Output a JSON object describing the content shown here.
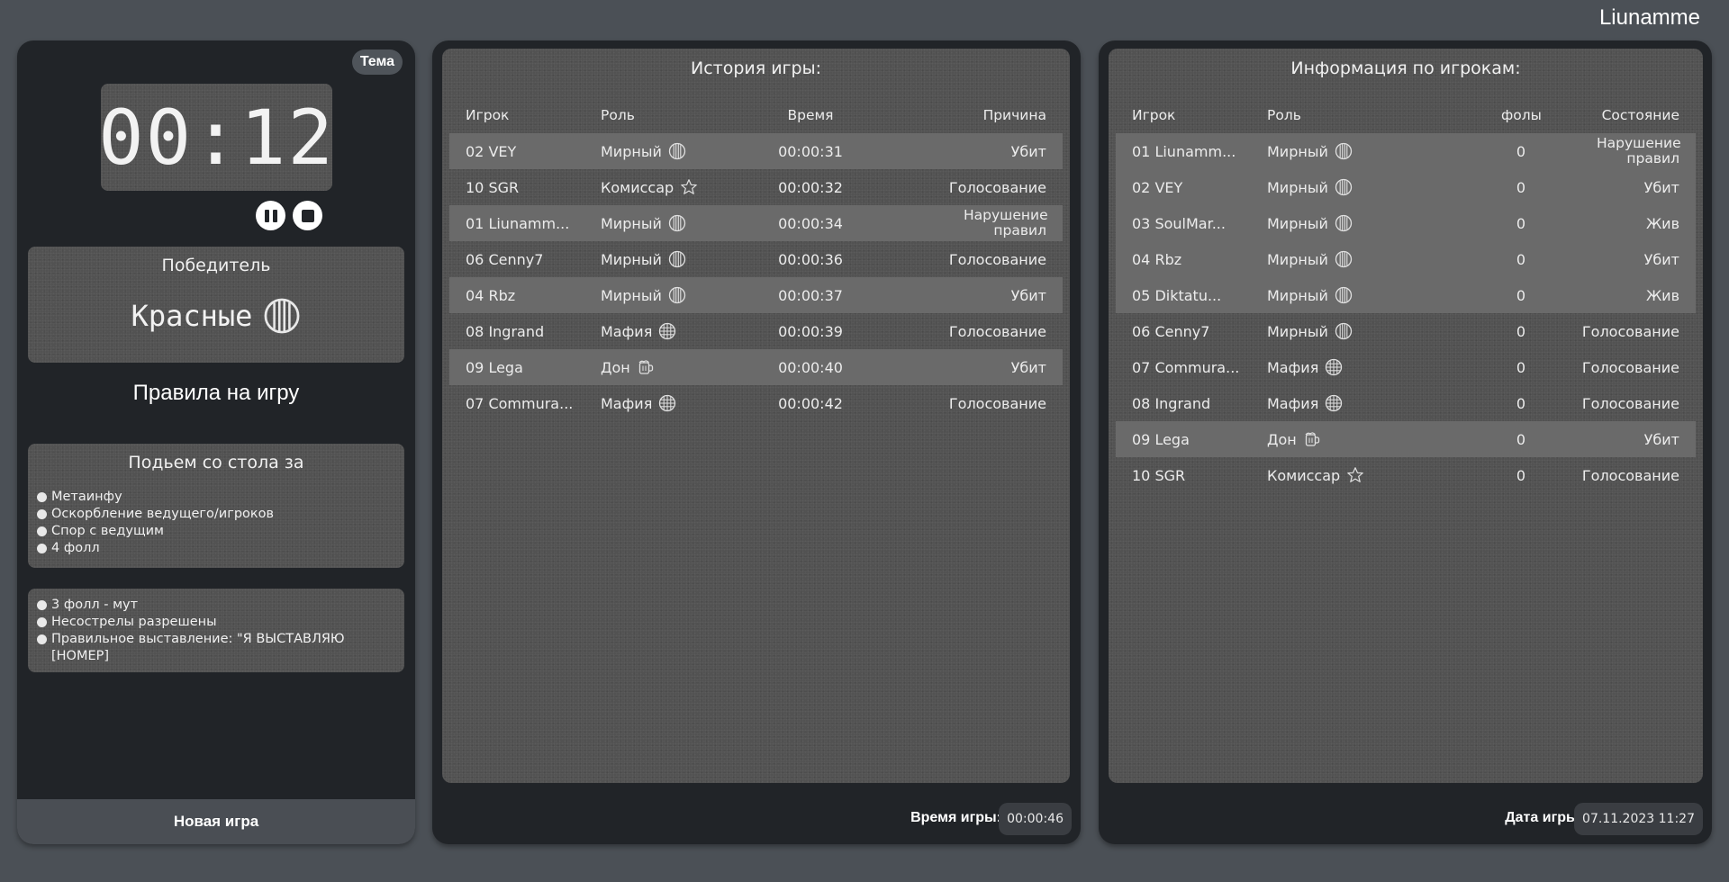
{
  "header": {
    "username": "Liunamme"
  },
  "left": {
    "theme_label": "Тема",
    "timer": "00:12",
    "winner": {
      "title": "Победитель",
      "team": "Красные",
      "team_icon": "striped-circle-icon"
    },
    "rules_title": "Правила на игру",
    "lift": {
      "title": "Подьем со стола за",
      "items": [
        "Метаинфу",
        "Оскорбление ведущего/игроков",
        "Спор с ведущим",
        "4 фолл"
      ]
    },
    "extra": {
      "items": [
        "3 фолл - мут",
        "Несострелы разрешены",
        "Правильное выставление: \"Я ВЫСТАВЛЯЮ [НОМЕР]"
      ]
    },
    "new_game_label": "Новая игра"
  },
  "history": {
    "title": "История игры:",
    "columns": {
      "player": "Игрок",
      "role": "Роль",
      "time": "Время",
      "reason": "Причина"
    },
    "rows": [
      {
        "player": "02 VEY",
        "role": "Мирный",
        "icon": "civilian",
        "time": "00:00:31",
        "reason": "Убит"
      },
      {
        "player": "10 SGR",
        "role": "Комиссар",
        "icon": "sheriff",
        "time": "00:00:32",
        "reason": "Голосование"
      },
      {
        "player": "01 Liunamm...",
        "role": "Мирный",
        "icon": "civilian",
        "time": "00:00:34",
        "reason": "Нарушение правил"
      },
      {
        "player": "06 Cenny7",
        "role": "Мирный",
        "icon": "civilian",
        "time": "00:00:36",
        "reason": "Голосование"
      },
      {
        "player": "04 Rbz",
        "role": "Мирный",
        "icon": "civilian",
        "time": "00:00:37",
        "reason": "Убит"
      },
      {
        "player": "08 Ingrand",
        "role": "Мафия",
        "icon": "mafia",
        "time": "00:00:39",
        "reason": "Голосование"
      },
      {
        "player": "09 Lega",
        "role": "Дон",
        "icon": "don",
        "time": "00:00:40",
        "reason": "Убит"
      },
      {
        "player": "07 Commura...",
        "role": "Мафия",
        "icon": "mafia",
        "time": "00:00:42",
        "reason": "Голосование"
      }
    ],
    "footer_label": "Время игры:",
    "footer_value": "00:00:46"
  },
  "players": {
    "title": "Информация по игрокам:",
    "columns": {
      "player": "Игрок",
      "role": "Роль",
      "fouls": "фолы",
      "state": "Состояние"
    },
    "rows": [
      {
        "player": "01 Liunamm...",
        "role": "Мирный",
        "icon": "civilian",
        "fouls": "0",
        "state": "Нарушение правил"
      },
      {
        "player": "02 VEY",
        "role": "Мирный",
        "icon": "civilian",
        "fouls": "0",
        "state": "Убит"
      },
      {
        "player": "03 SoulMar...",
        "role": "Мирный",
        "icon": "civilian",
        "fouls": "0",
        "state": "Жив"
      },
      {
        "player": "04 Rbz",
        "role": "Мирный",
        "icon": "civilian",
        "fouls": "0",
        "state": "Убит"
      },
      {
        "player": "05 Diktatu...",
        "role": "Мирный",
        "icon": "civilian",
        "fouls": "0",
        "state": "Жив"
      },
      {
        "player": "06 Cenny7",
        "role": "Мирный",
        "icon": "civilian",
        "fouls": "0",
        "state": "Голосование"
      },
      {
        "player": "07 Commura...",
        "role": "Мафия",
        "icon": "mafia",
        "fouls": "0",
        "state": "Голосование"
      },
      {
        "player": "08 Ingrand",
        "role": "Мафия",
        "icon": "mafia",
        "fouls": "0",
        "state": "Голосование"
      },
      {
        "player": "09 Lega",
        "role": "Дон",
        "icon": "don",
        "fouls": "0",
        "state": "Убит"
      },
      {
        "player": "10 SGR",
        "role": "Комиссар",
        "icon": "sheriff",
        "fouls": "0",
        "state": "Голосование"
      }
    ],
    "footer_label": "Дата игры:",
    "footer_value": "07.11.2023 11:27"
  },
  "colors": {
    "background": "#4b5056",
    "panel": "#212428",
    "card": "#525252",
    "row_alt": "#6a6a6a",
    "text": "#ececec"
  }
}
